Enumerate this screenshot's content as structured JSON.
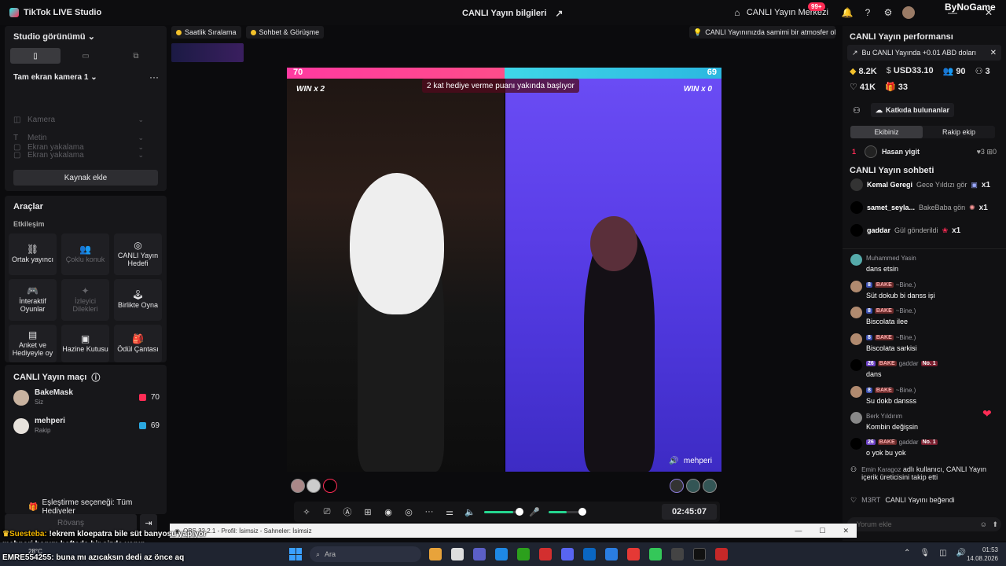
{
  "app": {
    "title": "TikTok LIVE Studio",
    "center_title": "CANLI Yayın bilgileri",
    "merkez": "CANLI Yayın Merkezi",
    "notif_badge": "99+",
    "watermark": "ByNoGame"
  },
  "studio": {
    "view_title": "Studio görünümü",
    "camera_title": "Tam ekran kamera 1",
    "sources": [
      "Kamera",
      "Metin",
      "Ekran yakalama",
      "Ekran yakalama"
    ],
    "add_source": "Kaynak ekle"
  },
  "tools": {
    "title": "Araçlar",
    "section": "Etkileşim",
    "items": [
      {
        "label": "Ortak yayıncı",
        "icon": "link-icon"
      },
      {
        "label": "Çoklu konuk",
        "icon": "users-icon"
      },
      {
        "label": "CANLI Yayın Hedefi",
        "icon": "target-icon"
      },
      {
        "label": "İnteraktif Oyunlar",
        "icon": "gamepad-icon"
      },
      {
        "label": "İzleyici Dilekleri",
        "icon": "wish-icon"
      },
      {
        "label": "Birlikte Oyna",
        "icon": "joystick-icon"
      },
      {
        "label": "Anket ve Hediyeyle oy",
        "icon": "poll-icon"
      },
      {
        "label": "Hazine Kutusu",
        "icon": "chest-icon"
      },
      {
        "label": "Ödül Çantası",
        "icon": "bag-icon"
      }
    ]
  },
  "match": {
    "title": "CANLI Yayın maçı",
    "players": [
      {
        "name": "BakeMask",
        "sub": "Siz",
        "score": "70",
        "color": "#fe2c55"
      },
      {
        "name": "mehperi",
        "sub": "Rakip",
        "score": "69",
        "color": "#2ba8e0"
      }
    ],
    "pairing": "Eşleştirme seçeneği: Tüm Hediyeler",
    "rematch": "Rövanş"
  },
  "chips": {
    "ranking": "Saatlik Sıralama",
    "chat_call": "Sohbet & Görüşme",
    "tip": "CANLI Yayınınızda samimi bir atmosfer olu..."
  },
  "stage": {
    "score_left": "70",
    "score_right": "69",
    "win_left": "WIN x 2",
    "win_right": "WIN x 0",
    "hint": "2 kat hediye verme puanı yakında başlıyor",
    "opponent_name": "mehperi",
    "timer": "02:45:07"
  },
  "performance": {
    "title": "CANLI Yayın performansı",
    "earning": "Bu CANLI Yayında +0.01 ABD doları",
    "stats_row1": [
      {
        "icon": "diamond-icon",
        "value": "8.2K"
      },
      {
        "icon": "coin-icon",
        "value": "USD33.10"
      },
      {
        "icon": "users-icon",
        "value": "90"
      },
      {
        "icon": "person-plus-icon",
        "value": "3"
      }
    ],
    "stats_row2": [
      {
        "icon": "heart-icon",
        "value": "41K"
      },
      {
        "icon": "gift-icon",
        "value": "33"
      }
    ],
    "contributors": "Katkıda bulunanlar",
    "tab_team": "Ekibiniz",
    "tab_rival": "Rakip ekip",
    "top": {
      "rank": "1",
      "name": "Hasan yigit",
      "likes": "3",
      "gifts": "0"
    }
  },
  "chat": {
    "title": "CANLI Yayın sohbeti",
    "gifts": [
      {
        "user": "Kemal Geregi",
        "text": "Gece Yıldızı gör",
        "count": "x1"
      },
      {
        "user": "samet_seyla...",
        "text": "BakeBaba gön",
        "count": "x1"
      },
      {
        "user": "gaddar",
        "text": "Gül gönderildi",
        "count": "x1"
      }
    ],
    "messages": [
      {
        "user": "Muhammed Yasin",
        "level": "",
        "tag": "",
        "text": "dans etsin"
      },
      {
        "user": "~Bine.)",
        "level": "8",
        "tag": "BAKE",
        "text": "Süt dokub bi danss işi"
      },
      {
        "user": "~Bine.)",
        "level": "8",
        "tag": "BAKE",
        "text": "Biscolata ilee"
      },
      {
        "user": "~Bine.)",
        "level": "8",
        "tag": "BAKE",
        "text": "Biscolata sarkisi"
      },
      {
        "user": "gaddar",
        "level": "26",
        "tag": "BAKE",
        "text": "dans",
        "extra": "No. 1"
      },
      {
        "user": "~Bine.)",
        "level": "8",
        "tag": "BAKE",
        "text": "Su dokb dansss"
      },
      {
        "user": "Berk Yıldırım",
        "level": "",
        "tag": "",
        "text": "Kombin değişsin"
      },
      {
        "user": "gaddar",
        "level": "26",
        "tag": "BAKE",
        "text": "o yok bu yok",
        "extra": "No. 1"
      }
    ],
    "follow_line": {
      "user": "Emin Karagoz",
      "text": "adlı kullanıcı, CANLI Yayın içerik üreticisini takip etti"
    },
    "like_line": {
      "user": "M3RT",
      "text": "CANLI Yayını beğendi"
    },
    "input_placeholder": "Yorum ekle"
  },
  "obs": {
    "title": "OBS 32.2.1 - Profil: İsimsiz - Sahneler: İsimsiz"
  },
  "overlay": [
    {
      "name": "Suesteba:",
      "text": "!ekrem kloepatra bile süt banyosu yapıyor"
    },
    {
      "name": "",
      "text": "mehperi hanım haftada bir sizde yapın"
    },
    {
      "name": "EMRE554255:",
      "text": "buna mı azıcaksın dedi az önce aq"
    }
  ],
  "taskbar": {
    "search": "Ara",
    "temp": "28°C",
    "time": "01:53",
    "date": "14.08.2026"
  }
}
